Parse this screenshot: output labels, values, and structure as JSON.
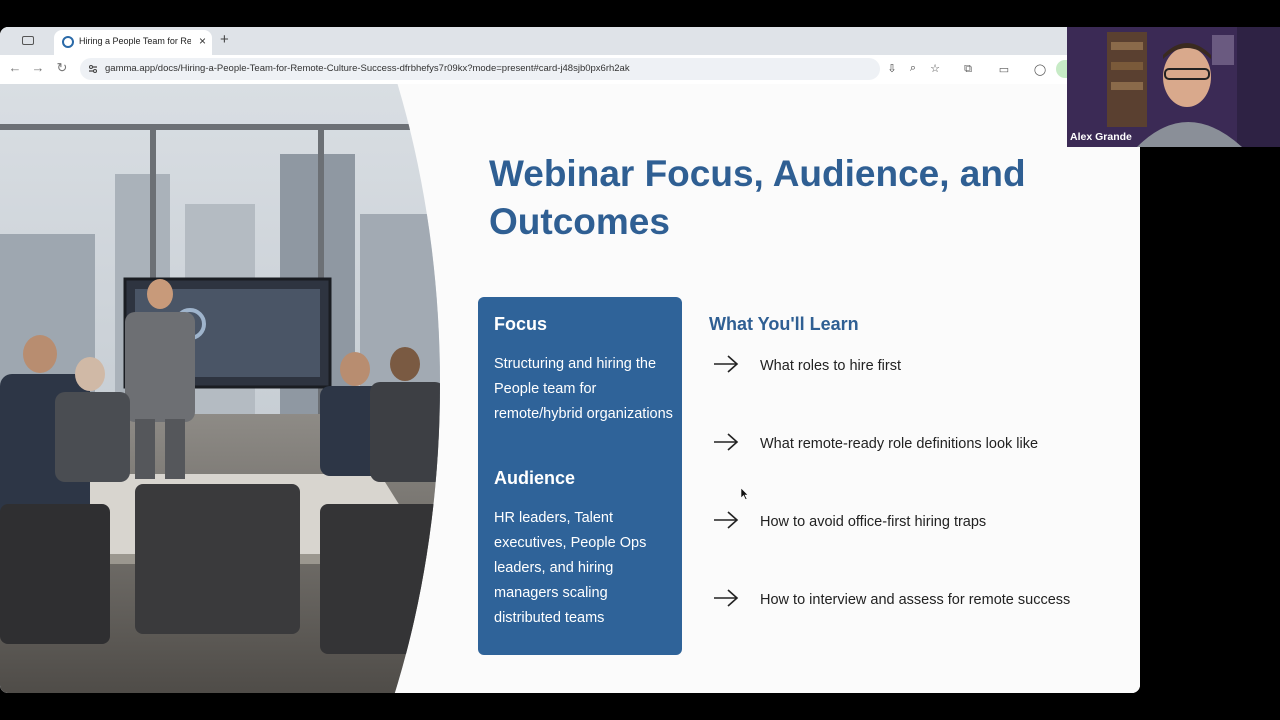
{
  "browser": {
    "tab_title": "Hiring a People Team for Remote Culture Success",
    "tab_close": "×",
    "new_tab": "+",
    "url": "gamma.app/docs/Hiring-a-People-Team-for-Remote-Culture-Success-dfrbhefys7r09kx?mode=present#card-j48sjb0px6rh2ak",
    "icons": [
      "tab-strip-icon",
      "back-icon",
      "forward-icon",
      "reload-icon",
      "site-info-icon",
      "install-icon",
      "zoom-icon",
      "bookmark-star-icon",
      "extensions-icon",
      "tab-search-icon",
      "profile-icon"
    ]
  },
  "slide": {
    "title": "Webinar Focus, Audience, and Outcomes",
    "focus_heading": "Focus",
    "focus_text": "Structuring and hiring the People team for remote/hybrid organizations",
    "audience_heading": "Audience",
    "audience_text": "HR leaders, Talent executives, People Ops leaders, and hiring managers scaling distributed teams",
    "learn_heading": "What You'll Learn",
    "learn_items": [
      "What roles to hire first",
      "What remote-ready role definitions look like",
      "How to avoid office-first hiring traps",
      "How to interview and assess for remote success"
    ],
    "accent_color": "#2f5f93",
    "card_color": "#2f6399"
  },
  "webcam": {
    "name": "Alex Grande"
  }
}
